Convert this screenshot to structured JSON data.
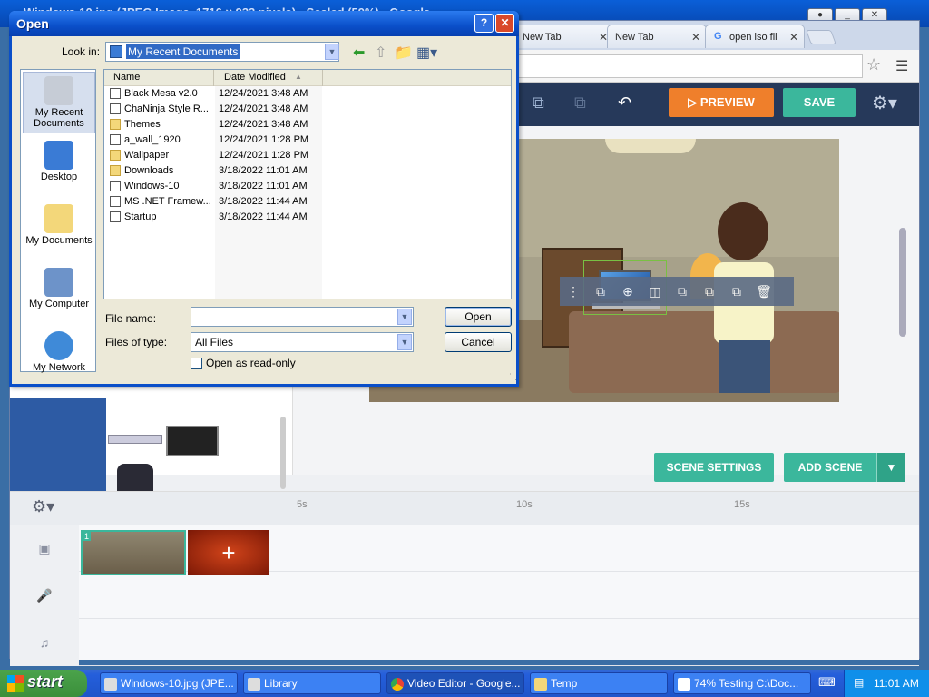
{
  "window_title": "Windows-10.jpg (JPEG Image, 1716 × 933 pixels) - Scaled (59%) - Google",
  "browser": {
    "tabs": [
      {
        "label": "New Tab"
      },
      {
        "label": "New Tab"
      },
      {
        "label": "open iso fil"
      }
    ]
  },
  "editor": {
    "preview_label": "PREVIEW",
    "save_label": "SAVE",
    "scene_settings_label": "SCENE SETTINGS",
    "add_scene_label": "ADD SCENE",
    "timeline_ticks": [
      "5s",
      "10s",
      "15s"
    ],
    "scene_number": "1",
    "colors": {
      "nav": "#26395a",
      "preview": "#ef7f2b",
      "teal": "#3bb79c"
    }
  },
  "dialog": {
    "title": "Open",
    "look_in_label": "Look in:",
    "look_in_value": "My Recent Documents",
    "places": [
      {
        "label": "My Recent Documents",
        "icon": "recent-documents-icon"
      },
      {
        "label": "Desktop",
        "icon": "desktop-icon"
      },
      {
        "label": "My Documents",
        "icon": "my-documents-icon"
      },
      {
        "label": "My Computer",
        "icon": "my-computer-icon"
      },
      {
        "label": "My Network",
        "icon": "my-network-icon"
      }
    ],
    "columns": {
      "name": "Name",
      "date": "Date Modified"
    },
    "files": [
      {
        "name": "Black Mesa v2.0",
        "date": "12/24/2021 3:48 AM",
        "type": "shortcut"
      },
      {
        "name": "ChaNinja Style R...",
        "date": "12/24/2021 3:48 AM",
        "type": "shortcut"
      },
      {
        "name": "Themes",
        "date": "12/24/2021 3:48 AM",
        "type": "folder"
      },
      {
        "name": "a_wall_1920",
        "date": "12/24/2021 1:28 PM",
        "type": "image"
      },
      {
        "name": "Wallpaper",
        "date": "12/24/2021 1:28 PM",
        "type": "folder"
      },
      {
        "name": "Downloads",
        "date": "3/18/2022 11:01 AM",
        "type": "folder"
      },
      {
        "name": "Windows-10",
        "date": "3/18/2022 11:01 AM",
        "type": "image"
      },
      {
        "name": "MS .NET Framew...",
        "date": "3/18/2022 11:44 AM",
        "type": "shortcut"
      },
      {
        "name": "Startup",
        "date": "3/18/2022 11:44 AM",
        "type": "shortcut"
      }
    ],
    "file_name_label": "File name:",
    "file_name_value": "",
    "files_of_type_label": "Files of type:",
    "files_of_type_value": "All Files",
    "open_label": "Open",
    "cancel_label": "Cancel",
    "readonly_label": "Open as read-only"
  },
  "taskbar": {
    "start_label": "start",
    "tasks": [
      {
        "label": "Windows-10.jpg (JPE..."
      },
      {
        "label": "Library"
      },
      {
        "label": "Video Editor - Google..."
      },
      {
        "label": "Temp"
      },
      {
        "label": "74% Testing C:\\Doc..."
      }
    ],
    "clock": "11:01 AM"
  }
}
